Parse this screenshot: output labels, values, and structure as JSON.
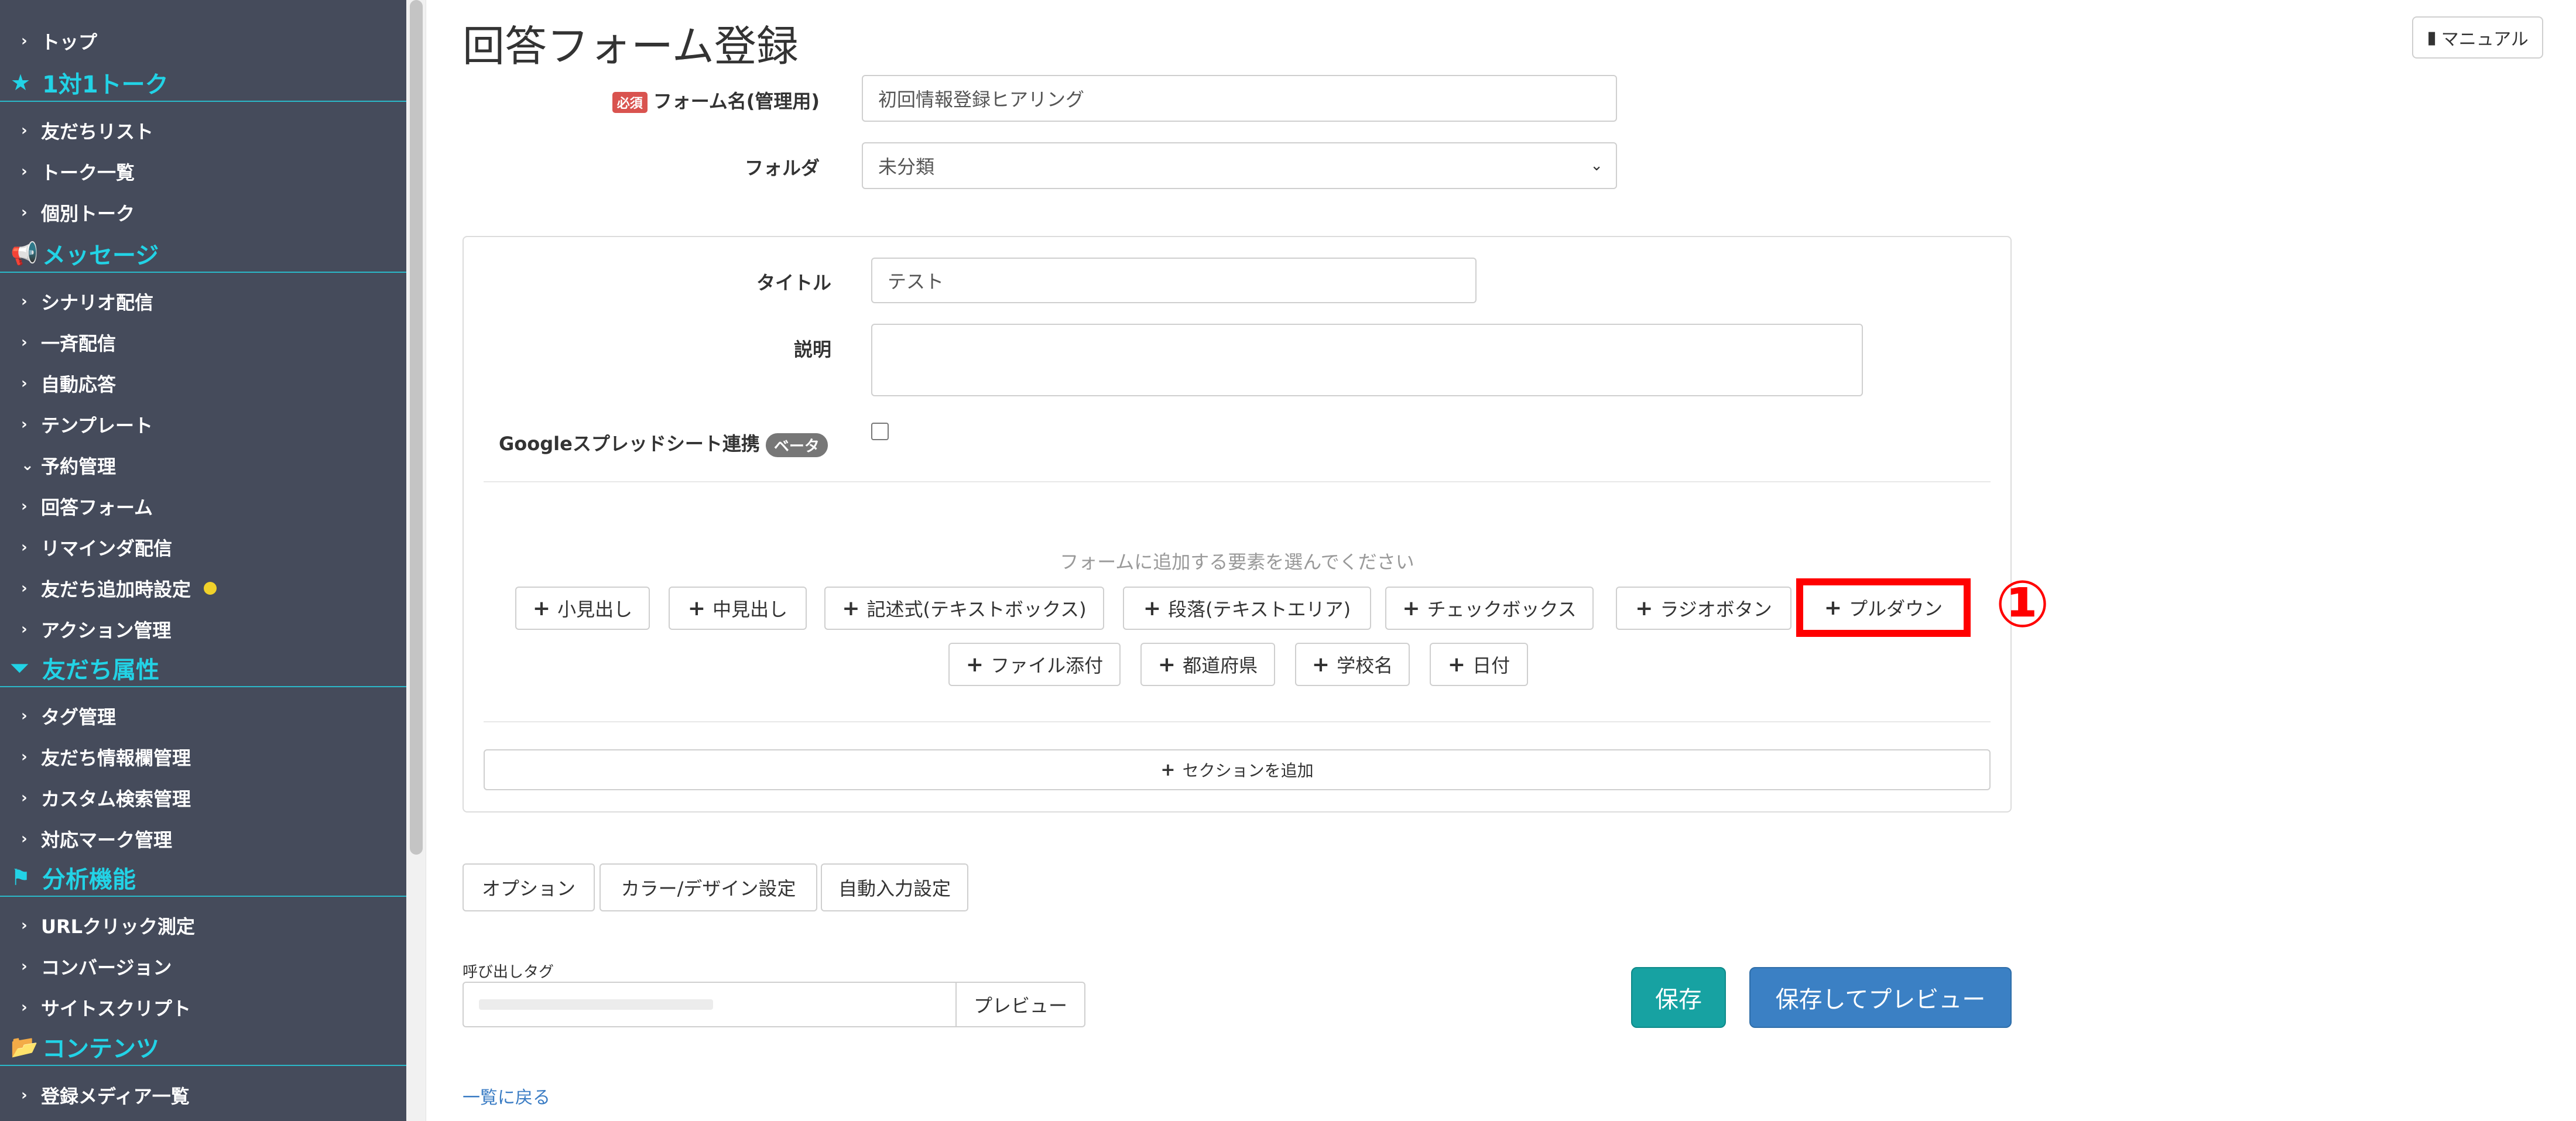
{
  "sidebar": {
    "items": [
      {
        "label": "トップ"
      },
      {
        "label": "1対1トーク"
      },
      {
        "label": "友だちリスト"
      },
      {
        "label": "トーク一覧"
      },
      {
        "label": "個別トーク"
      },
      {
        "label": "メッセージ"
      },
      {
        "label": "シナリオ配信"
      },
      {
        "label": "一斉配信"
      },
      {
        "label": "自動応答"
      },
      {
        "label": "テンプレート"
      },
      {
        "label": "予約管理"
      },
      {
        "label": "回答フォーム"
      },
      {
        "label": "リマインダ配信"
      },
      {
        "label": "友だち追加時設定"
      },
      {
        "label": "アクション管理"
      },
      {
        "label": "友だち属性"
      },
      {
        "label": "タグ管理"
      },
      {
        "label": "友だち情報欄管理"
      },
      {
        "label": "カスタム検索管理"
      },
      {
        "label": "対応マーク管理"
      },
      {
        "label": "分析機能"
      },
      {
        "label": "URLクリック測定"
      },
      {
        "label": "コンバージョン"
      },
      {
        "label": "サイトスクリプト"
      },
      {
        "label": "コンテンツ"
      },
      {
        "label": "登録メディア一覧"
      }
    ]
  },
  "header": {
    "title": "回答フォーム登録",
    "manual_label": "マニュアル"
  },
  "form": {
    "required_badge": "必須",
    "name_label": "フォーム名(管理用)",
    "name_value": "初回情報登録ヒアリング",
    "folder_label": "フォルダ",
    "folder_value": "未分類"
  },
  "panel": {
    "title_label": "タイトル",
    "title_value": "テスト",
    "description_label": "説明",
    "description_value": "",
    "sheets_label": "Googleスプレッドシート連携",
    "beta_badge": "ベータ",
    "add_hint": "フォームに追加する要素を選んでください",
    "add_buttons_row1": [
      "小見出し",
      "中見出し",
      "記述式(テキストボックス)",
      "段落(テキストエリア)",
      "チェックボックス",
      "ラジオボタン",
      "プルダウン"
    ],
    "add_buttons_row2": [
      "ファイル添付",
      "都道府県",
      "学校名",
      "日付"
    ],
    "add_section_label": "セクションを追加",
    "highlight_marker": "①"
  },
  "bottom": {
    "options_label": "オプション",
    "color_label": "カラー/デザイン設定",
    "autofill_label": "自動入力設定",
    "call_tag_label": "呼び出しタグ",
    "preview_label": "プレビュー",
    "save_label": "保存",
    "save_preview_label": "保存してプレビュー",
    "back_link": "一覧に戻る"
  },
  "colors": {
    "sidebar_bg": "#454b5b",
    "sidebar_heading": "#22d3e6",
    "save": "#17a2a2",
    "save_preview": "#3b80c4",
    "highlight": "#ff0000"
  }
}
